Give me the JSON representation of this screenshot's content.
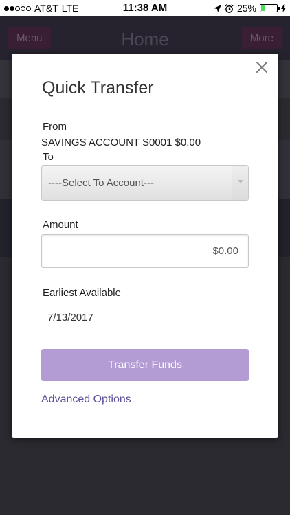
{
  "status_bar": {
    "carrier": "AT&T",
    "network": "LTE",
    "time": "11:38 AM",
    "battery_percent": "25%",
    "battery_level": 0.25,
    "signal_bars_filled": 2,
    "signal_bars_total": 5
  },
  "app": {
    "title": "Home",
    "menu_label": "Menu",
    "more_label": "More"
  },
  "modal": {
    "title": "Quick Transfer",
    "from_label": "From",
    "from_value": "SAVINGS ACCOUNT S0001 $0.00",
    "to_label": "To",
    "to_select_value": "----Select To Account---",
    "amount_label": "Amount",
    "amount_value": "$0.00",
    "earliest_label": "Earliest Available",
    "earliest_value": "7/13/2017",
    "transfer_button_label": "Transfer Funds",
    "advanced_link_label": "Advanced Options"
  },
  "colors": {
    "accent": "#b39cd4",
    "link": "#5d4f9a",
    "battery": "#4cd964"
  },
  "icons": {
    "close": "close-icon",
    "location": "location-arrow-icon",
    "alarm": "alarm-clock-icon",
    "charging": "charging-bolt-icon"
  }
}
